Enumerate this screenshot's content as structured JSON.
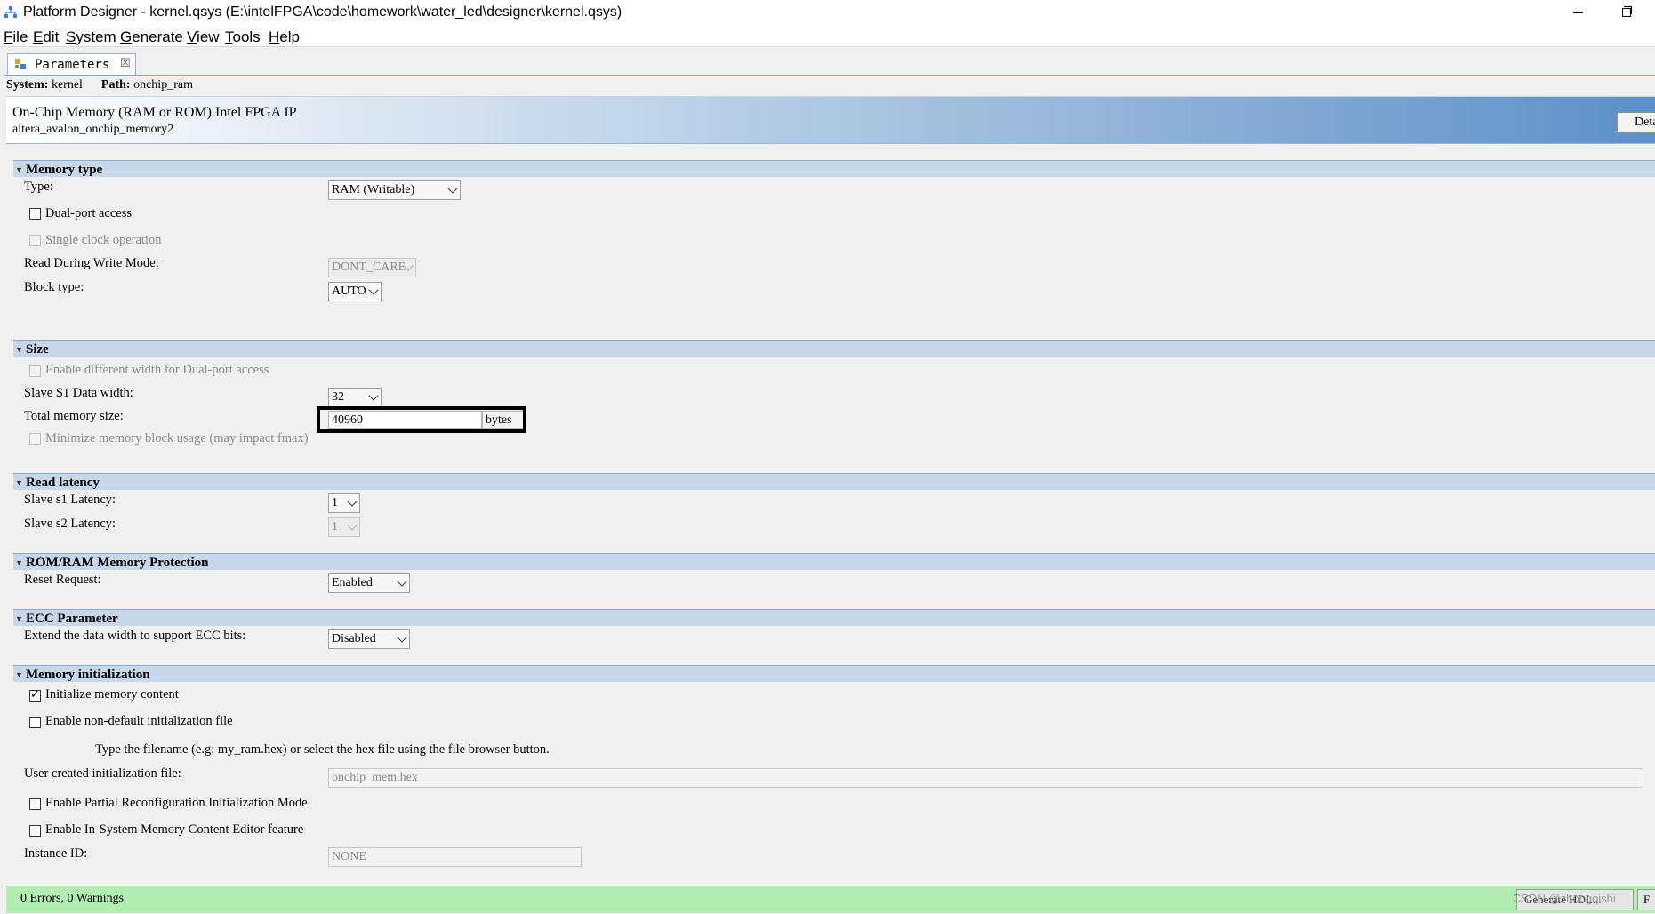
{
  "window": {
    "title": "Platform Designer - kernel.qsys (E:\\intelFPGA\\code\\homework\\water_led\\designer\\kernel.qsys)"
  },
  "menu": [
    "File",
    "Edit",
    "System",
    "Generate",
    "View",
    "Tools",
    "Help"
  ],
  "tab": {
    "label": "Parameters",
    "close": "☒"
  },
  "path": {
    "system_label": "System:",
    "system_value": "kernel",
    "path_label": "Path:",
    "path_value": "onchip_ram"
  },
  "component": {
    "title": "On-Chip Memory (RAM or ROM) Intel FPGA IP",
    "id": "altera_avalon_onchip_memory2",
    "details_label": "Deta"
  },
  "sections": {
    "memory_type": {
      "header": "Memory type",
      "type_label": "Type:",
      "type_value": "RAM (Writable)",
      "dual_port_label": "Dual-port access",
      "single_clock_label": "Single clock operation",
      "rdw_label": "Read During Write Mode:",
      "rdw_value": "DONT_CARE",
      "block_type_label": "Block type:",
      "block_type_value": "AUTO"
    },
    "size": {
      "header": "Size",
      "diff_width_label": "Enable different width for Dual-port access",
      "s1_width_label": "Slave S1 Data width:",
      "s1_width_value": "32",
      "total_size_label": "Total memory size:",
      "total_size_value": "40960",
      "total_size_unit": "bytes",
      "minimize_label": "Minimize memory block usage (may impact fmax)"
    },
    "read_latency": {
      "header": "Read latency",
      "s1_latency_label": "Slave s1 Latency:",
      "s1_latency_value": "1",
      "s2_latency_label": "Slave s2 Latency:",
      "s2_latency_value": "1"
    },
    "protection": {
      "header": "ROM/RAM Memory Protection",
      "reset_label": "Reset Request:",
      "reset_value": "Enabled"
    },
    "ecc": {
      "header": "ECC Parameter",
      "ecc_label": "Extend the data width to support ECC bits:",
      "ecc_value": "Disabled"
    },
    "init": {
      "header": "Memory initialization",
      "init_content_label": "Initialize memory content",
      "non_default_label": "Enable non-default initialization file",
      "hint": "Type the filename (e.g: my_ram.hex) or select the hex file using the file browser button.",
      "user_file_label": "User created initialization file:",
      "user_file_value": "onchip_mem.hex",
      "partial_reconfig_label": "Enable Partial Reconfiguration Initialization Mode",
      "in_system_label": "Enable In-System Memory Content Editor feature",
      "instance_id_label": "Instance ID:",
      "instance_id_value": "NONE"
    }
  },
  "status": {
    "text": "0 Errors, 0 Warnings",
    "generate_hdl_label": "Generate HDL...",
    "edge_btn_label": "F",
    "watermark": "CSDN @zhongqishi"
  }
}
